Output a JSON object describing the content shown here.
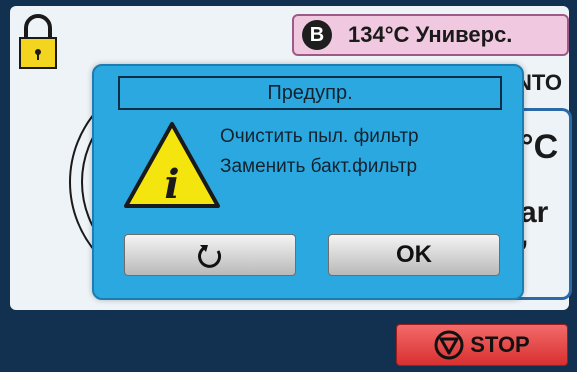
{
  "header": {
    "program_letter": "B",
    "program_name": "134°C Универс.",
    "mode_fragment": "NTO"
  },
  "readings": {
    "temp_fragment": "°C",
    "pressure_fragment": "ar",
    "time_fragment": "’"
  },
  "dialog": {
    "title": "Предупр.",
    "messages": [
      "Очистить пыл. фильтр",
      "Заменить бакт.фильтр"
    ],
    "reset_icon": "rotate-left-icon",
    "ok_label": "OK"
  },
  "footer": {
    "stop_label": "STOP"
  },
  "icons": {
    "lock": "lock-icon",
    "warning": "warning-info-icon",
    "stop": "stop-icon"
  },
  "colors": {
    "dialog_bg": "#2ba8df",
    "program_badge_bg": "#f0c8e0",
    "stop_button_bg": "#e04444",
    "lock_color": "#f3d520",
    "warning_color": "#f5e50f"
  }
}
